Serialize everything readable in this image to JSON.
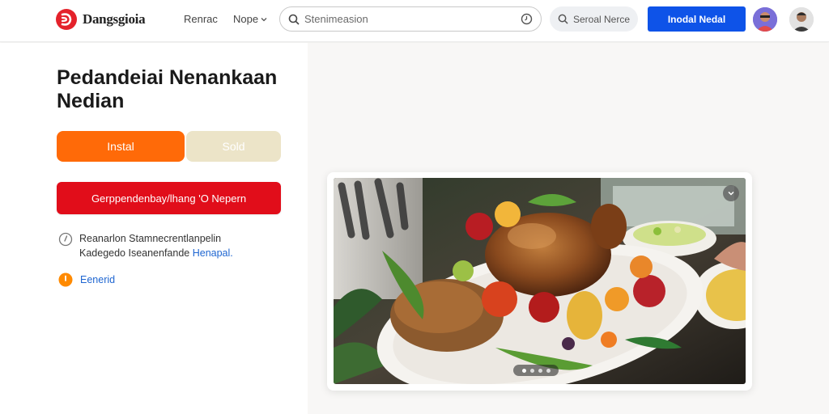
{
  "header": {
    "logo_text": "Dangsgioia",
    "nav": [
      {
        "label": "Renrac"
      },
      {
        "label": "Nope"
      }
    ],
    "search": {
      "placeholder": "Stenimeasion"
    },
    "secondary_search_label": "Seroal Nerce",
    "cta_label": "Inodal Nedal"
  },
  "hero": {
    "title": "Pedandeiai Nenankaan Nedian",
    "install_label": "Instal",
    "sold_label": "Sold",
    "primary_action_label": "Gerppendenbay/lhang 'O Nepern",
    "info": {
      "line1_text": "Reanarlon Stamnecrentlanpelin",
      "line2_text": "Kadegedo Iseanenfande ",
      "line2_link": "Henapal."
    },
    "general_label": "Eenerid"
  },
  "colors": {
    "accent_orange": "#ff6a08",
    "accent_red": "#e10d1a",
    "accent_blue": "#0e53e8",
    "link_blue": "#1f66d1"
  },
  "icons": {
    "logo": "brand-logo-icon",
    "search": "search-icon",
    "clock": "clock-icon",
    "info": "info-icon",
    "general": "orange-circle-icon"
  }
}
